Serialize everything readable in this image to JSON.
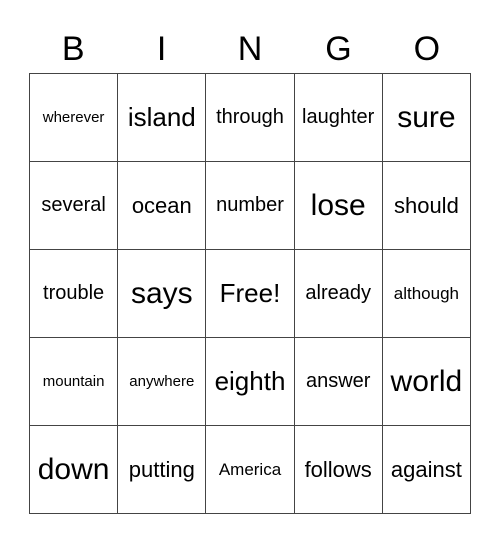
{
  "header": [
    "B",
    "I",
    "N",
    "G",
    "O"
  ],
  "cells": [
    {
      "text": "wherever",
      "size": "s1"
    },
    {
      "text": "island",
      "size": "s5"
    },
    {
      "text": "through",
      "size": "s3"
    },
    {
      "text": "laughter",
      "size": "s3"
    },
    {
      "text": "sure",
      "size": "s6"
    },
    {
      "text": "several",
      "size": "s3"
    },
    {
      "text": "ocean",
      "size": "s4"
    },
    {
      "text": "number",
      "size": "s3"
    },
    {
      "text": "lose",
      "size": "s6"
    },
    {
      "text": "should",
      "size": "s4"
    },
    {
      "text": "trouble",
      "size": "s3"
    },
    {
      "text": "says",
      "size": "s6"
    },
    {
      "text": "Free!",
      "size": "s5"
    },
    {
      "text": "already",
      "size": "s3"
    },
    {
      "text": "although",
      "size": "s2"
    },
    {
      "text": "mountain",
      "size": "s1"
    },
    {
      "text": "anywhere",
      "size": "s1"
    },
    {
      "text": "eighth",
      "size": "s5"
    },
    {
      "text": "answer",
      "size": "s3"
    },
    {
      "text": "world",
      "size": "s6"
    },
    {
      "text": "down",
      "size": "s6"
    },
    {
      "text": "putting",
      "size": "s4"
    },
    {
      "text": "America",
      "size": "s2"
    },
    {
      "text": "follows",
      "size": "s4"
    },
    {
      "text": "against",
      "size": "s4"
    }
  ]
}
